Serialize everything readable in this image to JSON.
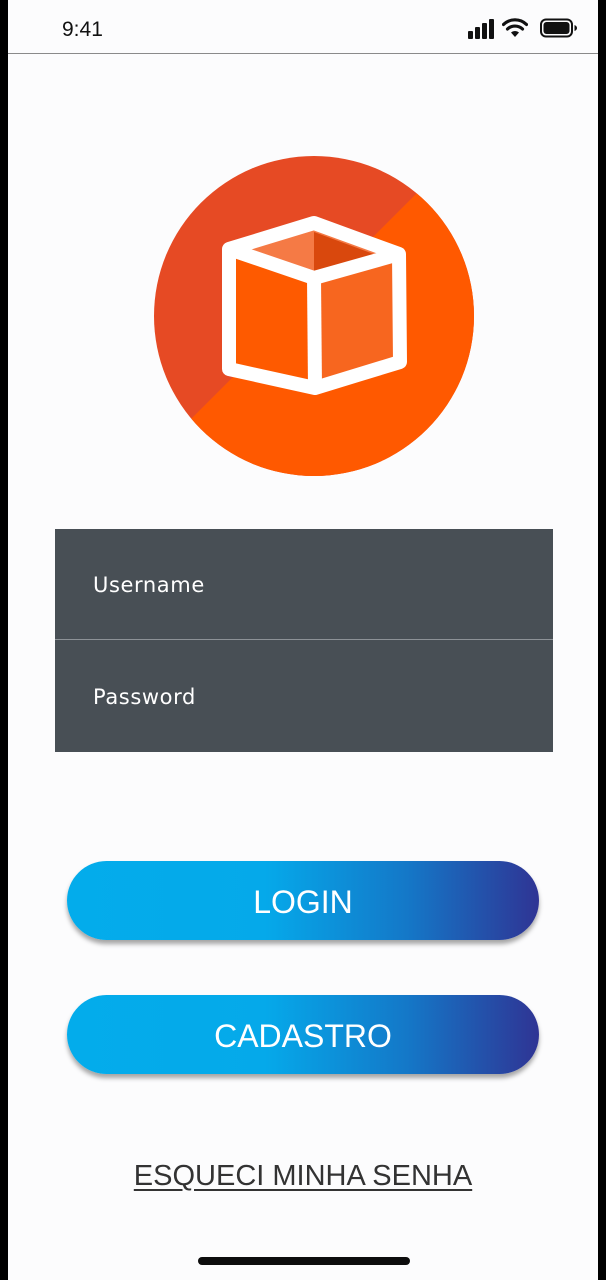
{
  "status_bar": {
    "time": "9:41",
    "icons": [
      "cellular-signal-icon",
      "wifi-icon",
      "battery-icon"
    ]
  },
  "logo": {
    "icon": "box-icon",
    "colors": {
      "circle_dark": "#e64a24",
      "circle_light": "#ff5900",
      "box_front": "#fe5a00",
      "box_side": "#f7661f",
      "box_top": "#f57a45",
      "box_top_inner": "#d9480d",
      "outline": "#ffffff"
    }
  },
  "form": {
    "username_placeholder": "Username",
    "password_placeholder": "Password",
    "background": "#484f55"
  },
  "buttons": {
    "login_label": "LOGIN",
    "cadastro_label": "CADASTRO",
    "gradient_colors": [
      "#03aceb",
      "#2f3494"
    ]
  },
  "forgot_password_label": "ESQUECI MINHA SENHA"
}
